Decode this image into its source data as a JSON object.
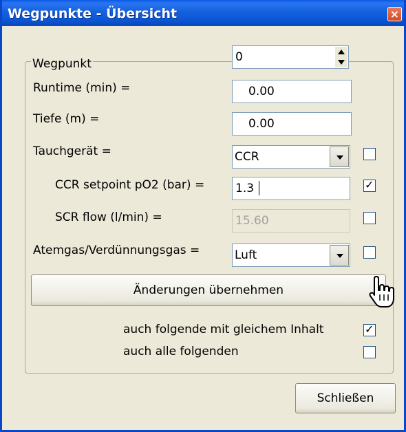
{
  "window": {
    "title": "Wegpunkte - Übersicht",
    "close_glyph": "×"
  },
  "group": {
    "legend": "Wegpunkt",
    "waypoint_value": "0"
  },
  "fields": {
    "runtime_label": "Runtime (min) =",
    "runtime_value": "0.00",
    "depth_label": "Tiefe (m) =",
    "depth_value": "0.00",
    "device_label": "Tauchgerät =",
    "device_value": "CCR",
    "device_checked": false,
    "setpoint_label": "CCR setpoint pO2 (bar) =",
    "setpoint_value": "1.3",
    "setpoint_checked": true,
    "scr_label": "SCR flow (l/min) =",
    "scr_value": "15.60",
    "scr_checked": false,
    "gas_label": "Atemgas/Verdünnungsgas =",
    "gas_value": "Luft",
    "gas_checked": false
  },
  "apply_button": "Änderungen übernehmen",
  "options": {
    "same_content_label": "auch folgende mit gleichem Inhalt",
    "same_content_checked": true,
    "all_following_label": "auch alle folgenden",
    "all_following_checked": false
  },
  "close_button": "Schließen",
  "check_glyph": "✓",
  "icons": {
    "spin": "spinner-arrows-icon",
    "combo": "chevron-down-icon",
    "cursor": "hand-pointer-icon"
  }
}
